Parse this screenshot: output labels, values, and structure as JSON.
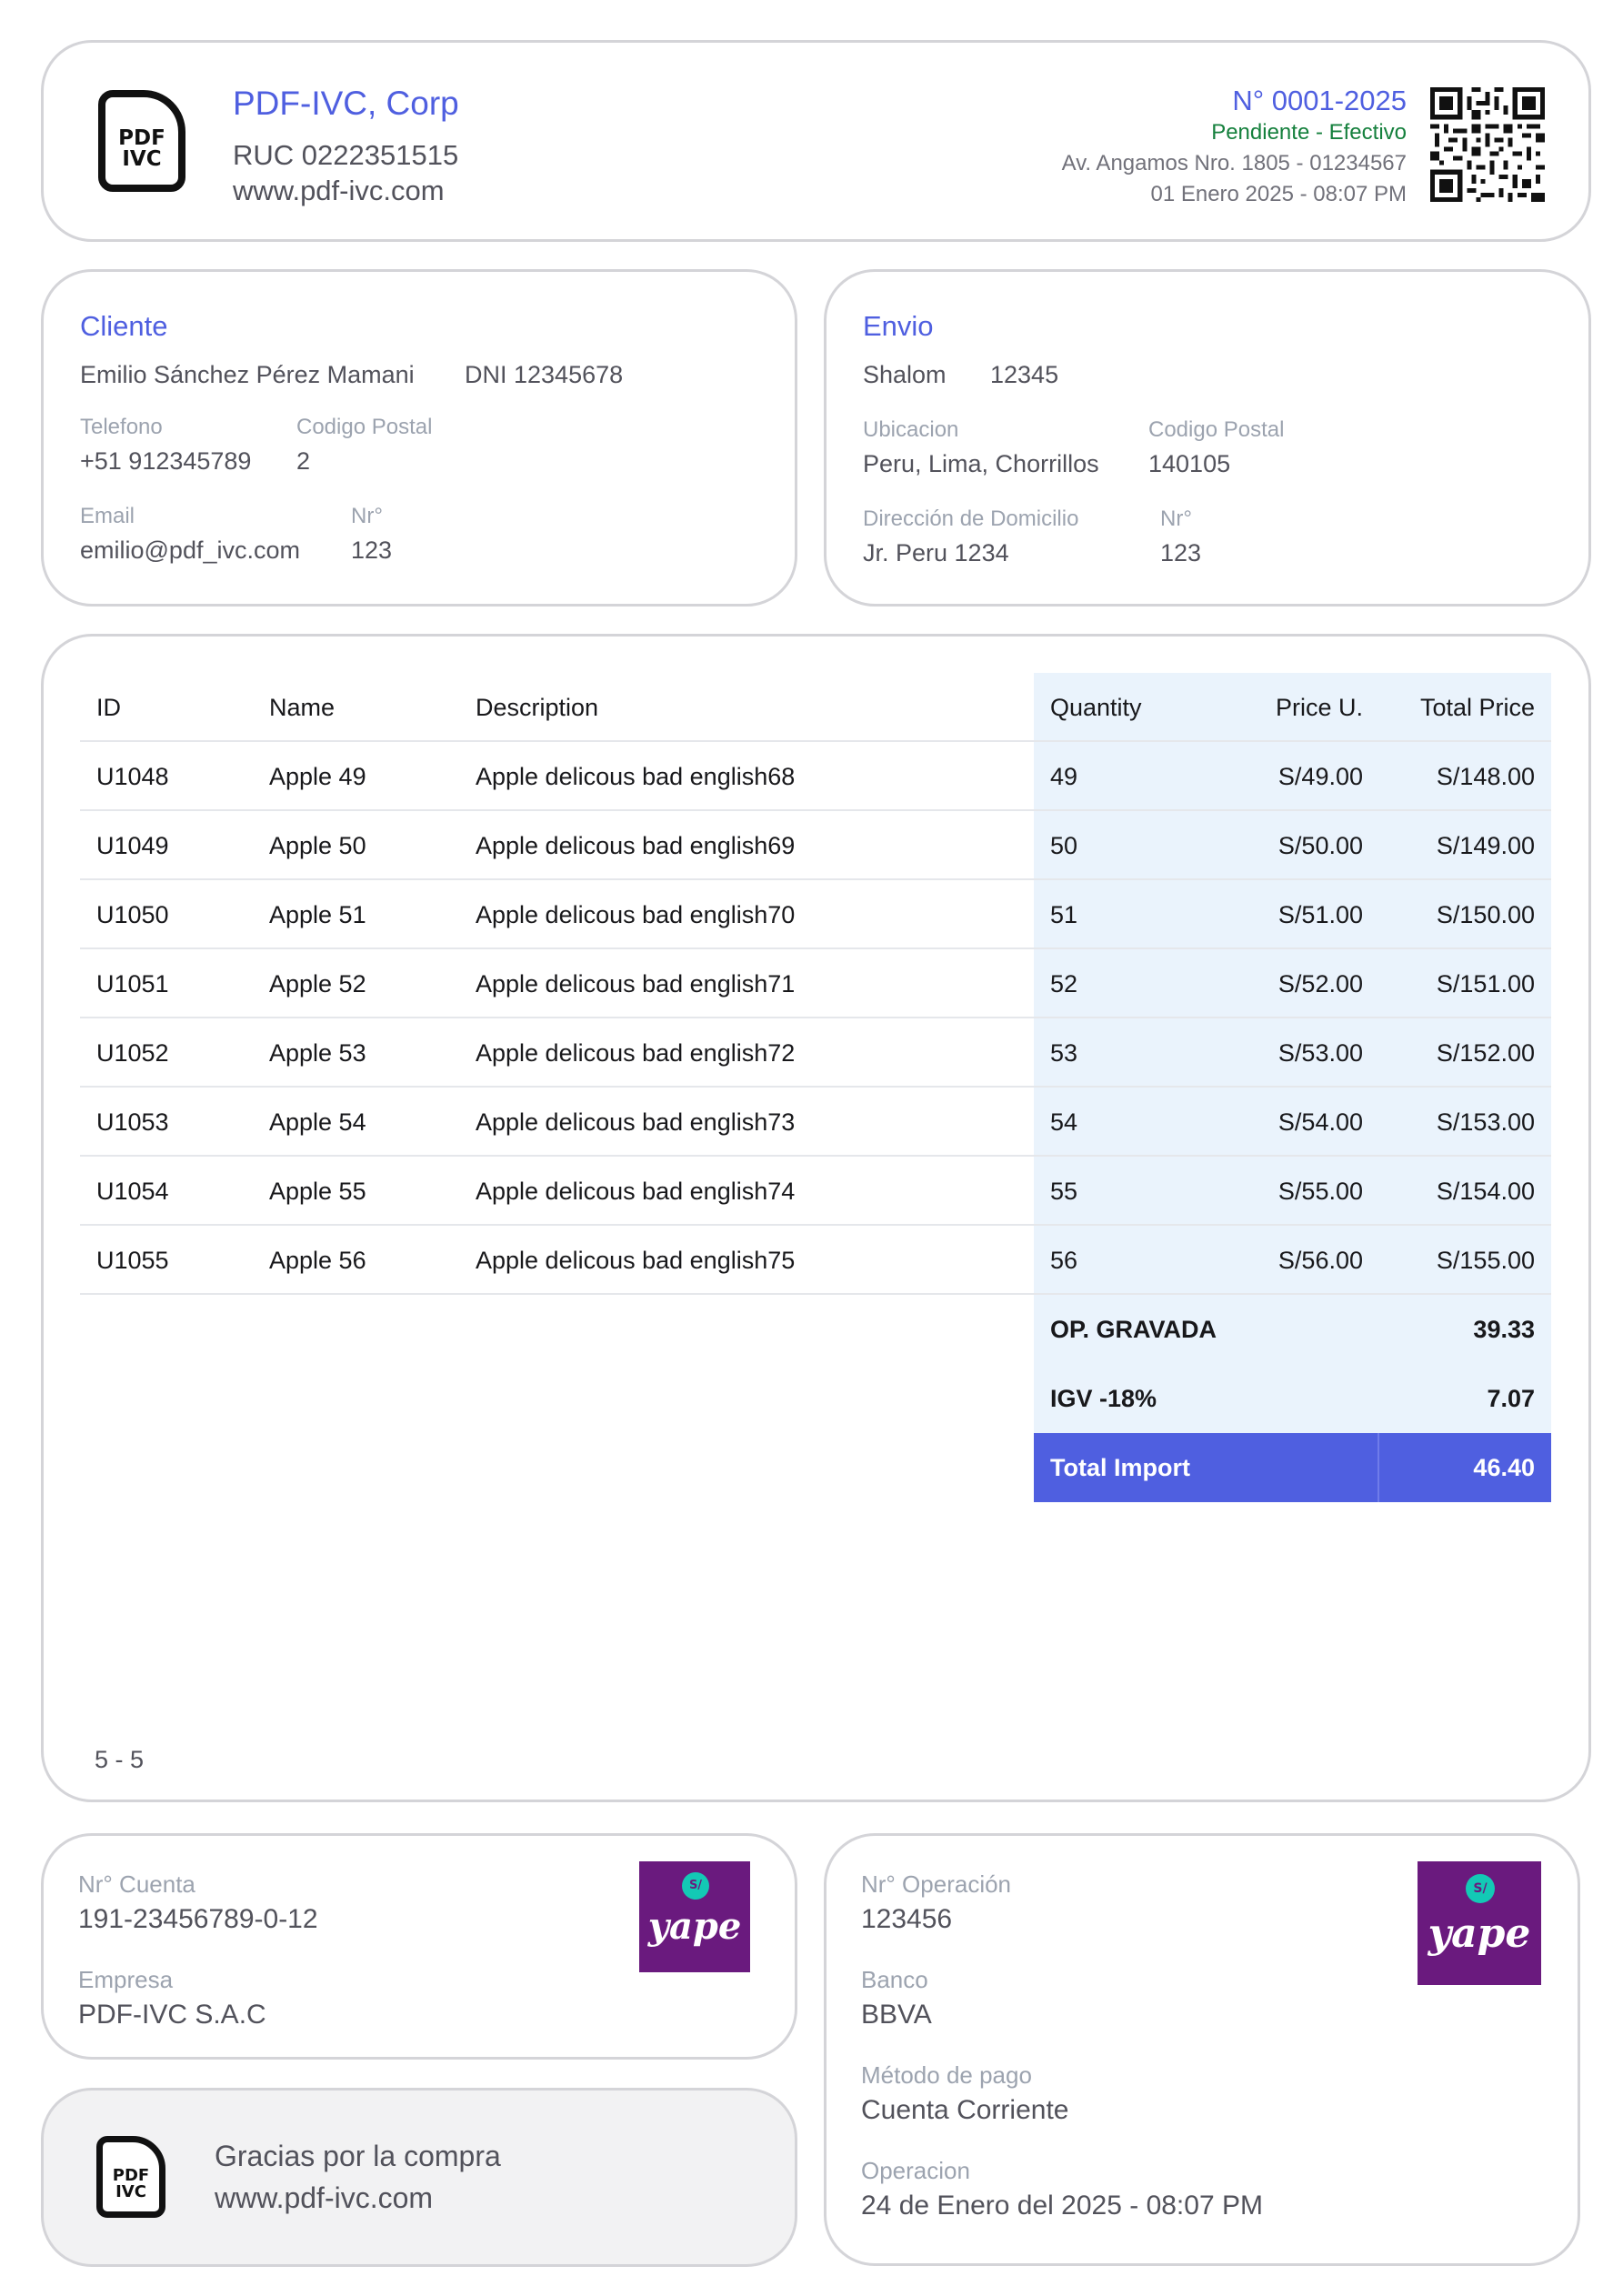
{
  "company": {
    "name": "PDF-IVC, Corp",
    "ruc": "RUC 0222351515",
    "website": "www.pdf-ivc.com",
    "logo_text_top": "PDF",
    "logo_text_bottom": "IVC"
  },
  "invoice": {
    "number": "N° 0001-2025",
    "status": "Pendiente - Efectivo",
    "address": "Av. Angamos Nro. 1805 - 01234567",
    "date": "01 Enero 2025 - 08:07 PM"
  },
  "client": {
    "heading": "Cliente",
    "name": "Emilio Sánchez Pérez Mamani",
    "dni": "DNI 12345678",
    "phone_label": "Telefono",
    "phone": "+51 912345789",
    "postal_label": "Codigo Postal",
    "postal": "2",
    "email_label": "Email",
    "email": "emilio@pdf_ivc.com",
    "nr_label": "Nr°",
    "nr": "123"
  },
  "shipping": {
    "heading": "Envio",
    "carrier": "Shalom",
    "carrier_code": "12345",
    "location_label": "Ubicacion",
    "location": "Peru, Lima, Chorrillos",
    "postal_label": "Codigo Postal",
    "postal": "140105",
    "address_label": "Dirección de Domicilio",
    "address": "Jr. Peru 1234",
    "nr_label": "Nr°",
    "nr": "123"
  },
  "table": {
    "headers": [
      "ID",
      "Name",
      "Description",
      "Quantity",
      "Price U.",
      "Total Price"
    ],
    "rows": [
      [
        "U1048",
        "Apple 49",
        "Apple delicous bad english68",
        "49",
        "S/49.00",
        "S/148.00"
      ],
      [
        "U1049",
        "Apple 50",
        "Apple delicous bad english69",
        "50",
        "S/50.00",
        "S/149.00"
      ],
      [
        "U1050",
        "Apple 51",
        "Apple delicous bad english70",
        "51",
        "S/51.00",
        "S/150.00"
      ],
      [
        "U1051",
        "Apple 52",
        "Apple delicous bad english71",
        "52",
        "S/52.00",
        "S/151.00"
      ],
      [
        "U1052",
        "Apple 53",
        "Apple delicous bad english72",
        "53",
        "S/53.00",
        "S/152.00"
      ],
      [
        "U1053",
        "Apple 54",
        "Apple delicous bad english73",
        "54",
        "S/54.00",
        "S/153.00"
      ],
      [
        "U1054",
        "Apple 55",
        "Apple delicous bad english74",
        "55",
        "S/55.00",
        "S/154.00"
      ],
      [
        "U1055",
        "Apple 56",
        "Apple delicous bad english75",
        "56",
        "S/56.00",
        "S/155.00"
      ]
    ],
    "op_gravada_label": "OP. GRAVADA",
    "op_gravada_value": "39.33",
    "igv_label": "IGV -18%",
    "igv_value": "7.07",
    "total_label": "Total Import",
    "total_value": "46.40",
    "pagination": "5 - 5"
  },
  "account": {
    "account_label": "Nr° Cuenta",
    "account_number": "191-23456789-0-12",
    "company_label": "Empresa",
    "company": "PDF-IVC S.A.C"
  },
  "operation": {
    "op_label": "Nr° Operación",
    "op_number": "123456",
    "bank_label": "Banco",
    "bank": "BBVA",
    "method_label": "Método de pago",
    "method": "Cuenta Corriente",
    "date_label": "Operacion",
    "date": "24 de Enero del 2025 - 08:07 PM"
  },
  "yape": {
    "bubble": "S/",
    "word": "yape"
  },
  "thanks": {
    "message": "Gracias por la compra",
    "website": "www.pdf-ivc.com"
  },
  "colors": {
    "accent": "#4f5fe0",
    "status_green": "#16a34a",
    "table_shade": "#eaf3fc",
    "yape_purple": "#6a1a7e"
  }
}
